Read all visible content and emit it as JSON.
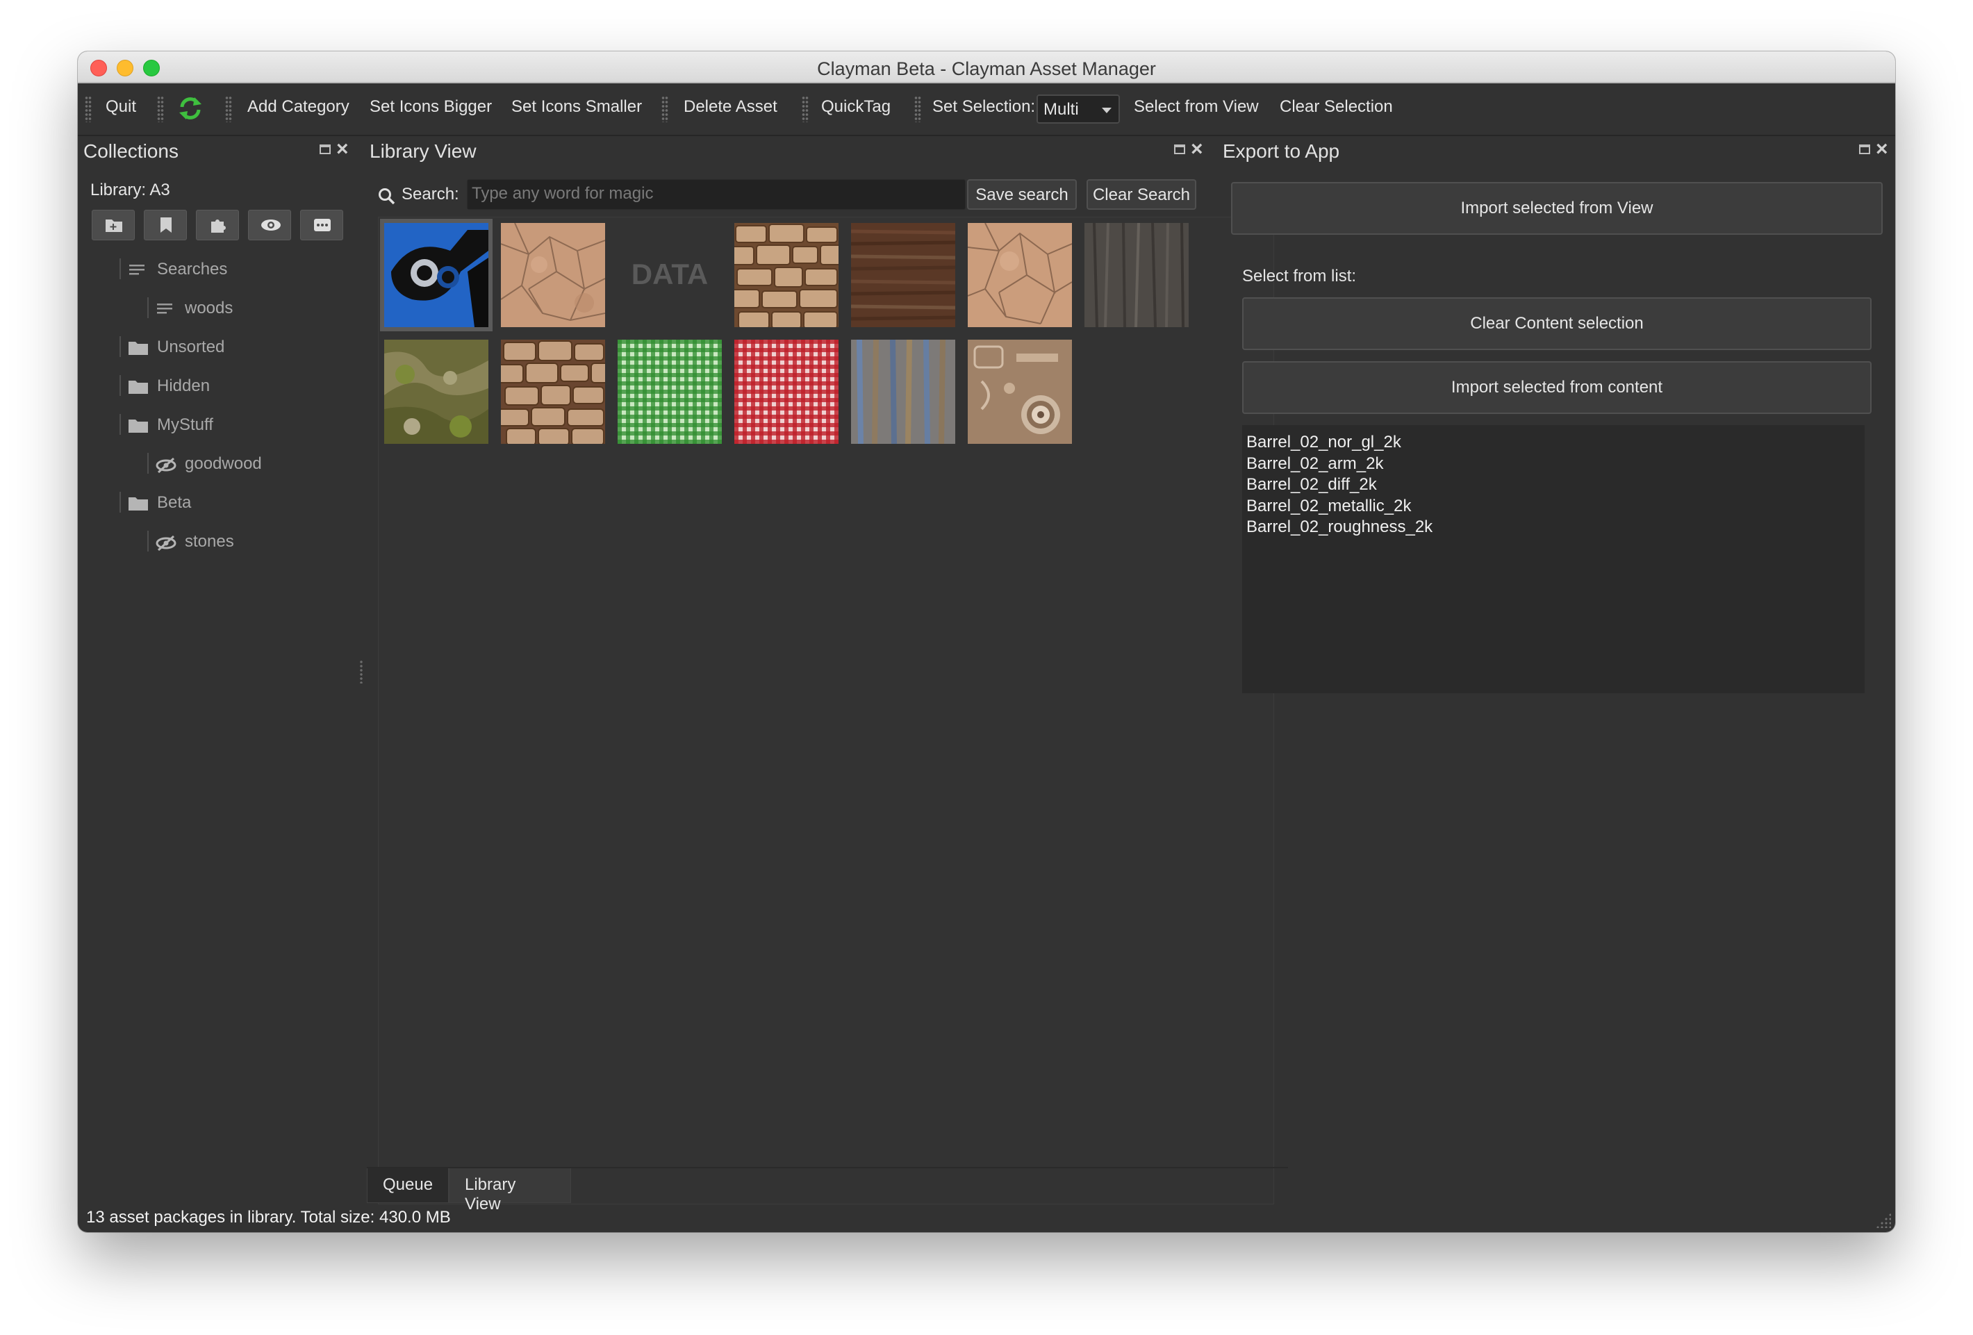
{
  "window": {
    "title": "Clayman Beta - Clayman Asset Manager"
  },
  "toolbar": {
    "quit": "Quit",
    "refresh_icon": "refresh-icon",
    "add_category": "Add Category",
    "set_icons_bigger": "Set Icons Bigger",
    "set_icons_smaller": "Set Icons Smaller",
    "delete_asset": "Delete Asset",
    "quicktag": "QuickTag",
    "set_selection_label": "Set Selection:",
    "set_selection_value": "Multi",
    "select_from_view": "Select from View",
    "clear_selection": "Clear Selection",
    "accent_color": "#3fbf3f"
  },
  "collections": {
    "title": "Collections",
    "library_label": "Library: A3",
    "buttons": [
      "add-folder-icon",
      "bookmark-icon",
      "puzzle-icon",
      "eye-icon",
      "more-icon"
    ],
    "tree": [
      {
        "label": "Searches",
        "icon": "list-icon"
      },
      {
        "label": "woods",
        "icon": "list-icon"
      },
      {
        "label": "Unsorted",
        "icon": "folder-icon"
      },
      {
        "label": "Hidden",
        "icon": "folder-icon"
      },
      {
        "label": "MyStuff",
        "icon": "folder-icon"
      },
      {
        "label": "goodwood",
        "icon": "eye-slash-icon"
      },
      {
        "label": "Beta",
        "icon": "folder-icon"
      },
      {
        "label": "stones",
        "icon": "eye-slash-icon"
      }
    ]
  },
  "library": {
    "title": "Library View",
    "search_label": "Search:",
    "search_placeholder": "Type any word for magic",
    "save_search": "Save search",
    "clear_search": "Clear Search",
    "data_tile_text": "DATA",
    "thumbnails": [
      "barrel",
      "sandstone",
      "data",
      "stone-wall",
      "wood-planks",
      "sandstone",
      "dark-wood",
      "mossy-rock",
      "stone-wall",
      "green-plaid",
      "red-plaid",
      "blue-wood",
      "mechanical"
    ]
  },
  "tabs": {
    "queue": "Queue",
    "library_view": "Library View"
  },
  "status": {
    "text": "13 asset packages in library. Total size: 430.0 MB"
  },
  "export": {
    "title": "Export to App",
    "import_from_view": "Import selected from View",
    "select_from_list": "Select from list:",
    "clear_content": "Clear Content selection",
    "import_from_content": "Import selected from content",
    "content_items": [
      "Barrel_02_nor_gl_2k",
      "Barrel_02_arm_2k",
      "Barrel_02_diff_2k",
      "Barrel_02_metallic_2k",
      "Barrel_02_roughness_2k"
    ]
  }
}
